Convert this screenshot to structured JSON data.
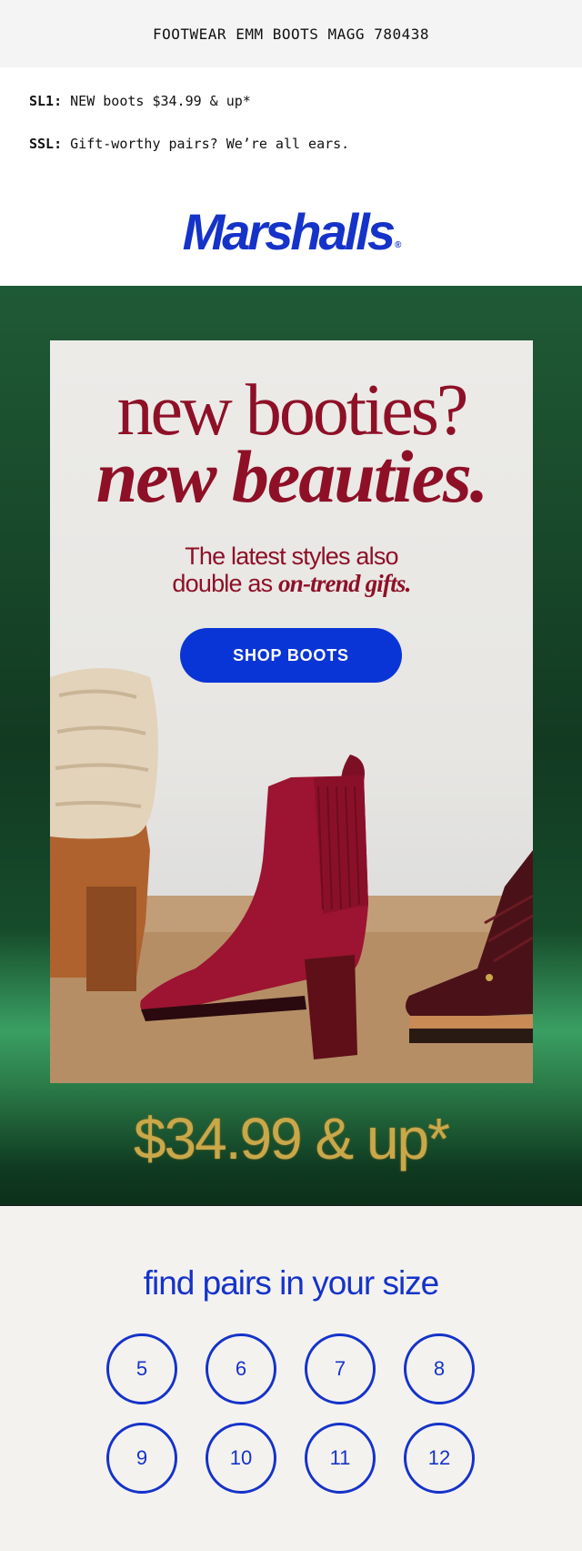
{
  "header": {
    "title": "FOOTWEAR EMM BOOTS MAGG 780438"
  },
  "meta": {
    "sl1_key": "SL1:",
    "sl1_value": "NEW boots $34.99 & up*",
    "ssl_key": "SSL:",
    "ssl_value": "Gift-worthy pairs? We’re all ears."
  },
  "brand": {
    "logo_text": "Marshalls",
    "registered_mark": "®"
  },
  "hero": {
    "headline_1": "new booties?",
    "headline_2": "new beauties.",
    "sub_line_1": "The latest styles also",
    "sub_line_2_plain": "double as",
    "sub_line_2_italic": "on-trend gifts.",
    "cta_label": "SHOP BOOTS",
    "price_text": "$34.99 & up*"
  },
  "size_finder": {
    "title": "find pairs in your size",
    "sizes": [
      "5",
      "6",
      "7",
      "8",
      "9",
      "10",
      "11",
      "12"
    ]
  },
  "colors": {
    "brand_blue": "#1533c9",
    "cta_blue": "#0a35d6",
    "burgundy": "#8e1027",
    "hero_green": "#123a22",
    "gold": "#c9a84a"
  }
}
